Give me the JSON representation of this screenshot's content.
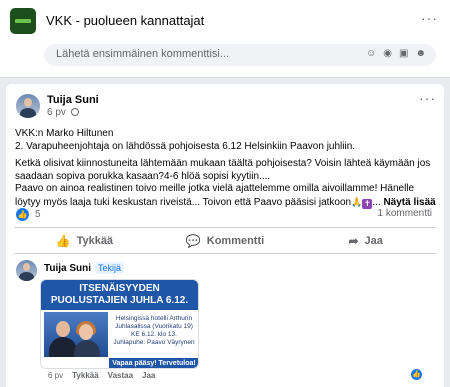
{
  "group": {
    "name": "VKK - puolueen kannattajat",
    "comment_placeholder": "Lähetä ensimmäinen kommenttisi...",
    "more": "···"
  },
  "post": {
    "author": "Tuija Suni",
    "time": "6 pv",
    "more": "···",
    "paragraphs": [
      "VKK:n Marko Hiltunen",
      "2. Varapuheenjohtaja on lähdössä pohjoisesta 6.12 Helsinkiin Paavon juhliin.",
      "Ketkä olisivat kiinnostuneita lähtemään mukaan täältä pohjoisesta? Voisin lähteä käymään jos saadaan sopiva porukka kasaan?4-6 hlöä sopisi kyytiin....",
      "Paavo on ainoa realistinen toivo meille jotka vielä ajattelemme omilla aivoillamme! Hänelle löytyy myös laaja tuki keskustan riveistä... Toivon että Paavo pääsisi jatkoon"
    ],
    "see_more": "Näytä lisää",
    "reaction_count": "5",
    "comment_count": "1 kommentti",
    "actions": {
      "like": "Tykkää",
      "comment": "Kommentti",
      "share": "Jaa"
    }
  },
  "comment": {
    "author": "Tuija Suni",
    "badge": "Tekijä",
    "image": {
      "title_line1": "ITSENÄISYYDEN",
      "title_line2": "PUOLUSTAJIEN JUHLA 6.12.",
      "line1": "Helsingissä hotelli Arthurin",
      "line2": "Juhlasalissa (Vuorikatu 19)",
      "line3": "KE 6.12. klo 13.",
      "line4": "Juhlapuhe: Paavo Väyrynen",
      "footer": "Vapaa pääsy! Tervetuloa!"
    },
    "time": "6 pv",
    "like": "Tykkää",
    "reply": "Vastaa",
    "share": "Jaa"
  }
}
